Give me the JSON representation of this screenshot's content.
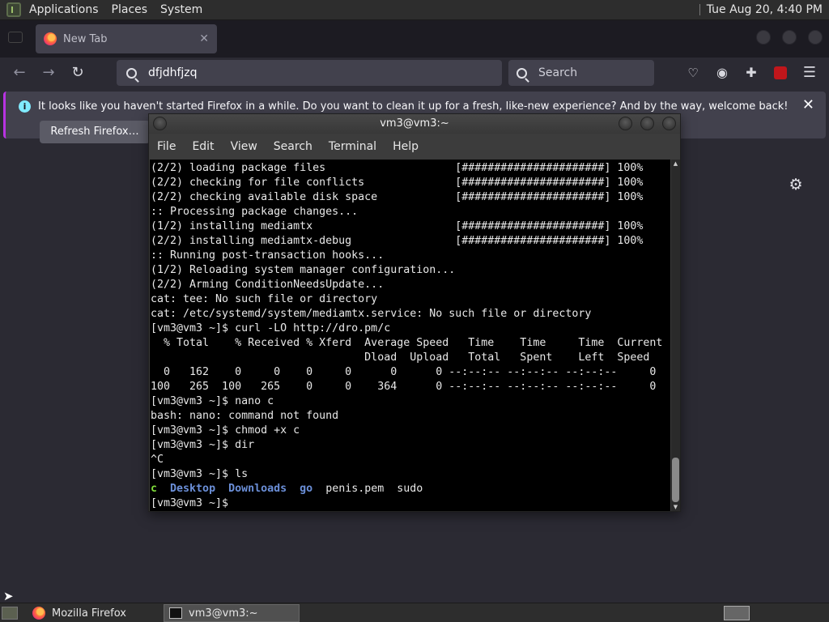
{
  "top_panel": {
    "menus": [
      "Applications",
      "Places",
      "System"
    ],
    "clock": "Tue Aug 20,  4:40 PM"
  },
  "firefox": {
    "tab_title": "New Tab",
    "url_value": "dfjdhfjzq",
    "search_placeholder": "Search",
    "notification": {
      "message": "It looks like you haven't started Firefox in a while. Do you want to clean it up for a fresh, like-new experience? And by the way, welcome back!",
      "button": "Refresh Firefox…"
    }
  },
  "terminal": {
    "title": "vm3@vm3:~",
    "menu": [
      "File",
      "Edit",
      "View",
      "Search",
      "Terminal",
      "Help"
    ],
    "lines": [
      "(2/2) loading package files                    [######################] 100%",
      "(2/2) checking for file conflicts              [######################] 100%",
      "(2/2) checking available disk space            [######################] 100%",
      ":: Processing package changes...",
      "(1/2) installing mediamtx                      [######################] 100%",
      "(2/2) installing mediamtx-debug                [######################] 100%",
      ":: Running post-transaction hooks...",
      "(1/2) Reloading system manager configuration...",
      "(2/2) Arming ConditionNeedsUpdate...",
      "cat: tee: No such file or directory",
      "cat: /etc/systemd/system/mediamtx.service: No such file or directory",
      "[vm3@vm3 ~]$ curl -LO http://dro.pm/c",
      "  % Total    % Received % Xferd  Average Speed   Time    Time     Time  Current",
      "                                 Dload  Upload   Total   Spent    Left  Speed",
      "  0   162    0     0    0     0      0      0 --:--:-- --:--:-- --:--:--     0",
      "100   265  100   265    0     0    364      0 --:--:-- --:--:-- --:--:--     0",
      "[vm3@vm3 ~]$ nano c",
      "bash: nano: command not found",
      "[vm3@vm3 ~]$ chmod +x c",
      "[vm3@vm3 ~]$ dir",
      "^C",
      "[vm3@vm3 ~]$ ls"
    ],
    "ls_output": [
      {
        "name": "c",
        "kind": "exe"
      },
      {
        "name": "Desktop",
        "kind": "dir"
      },
      {
        "name": "Downloads",
        "kind": "dir"
      },
      {
        "name": "go",
        "kind": "dir"
      },
      {
        "name": "penis.pem",
        "kind": "file"
      },
      {
        "name": "sudo",
        "kind": "file"
      }
    ],
    "prompt": "[vm3@vm3 ~]$ "
  },
  "taskbar": {
    "tasks": [
      "Mozilla Firefox",
      "vm3@vm3:~"
    ]
  },
  "colors": {
    "directory": "#6b8fd8",
    "executable": "#7fdc3a",
    "notification_accent": "#b833e1"
  }
}
